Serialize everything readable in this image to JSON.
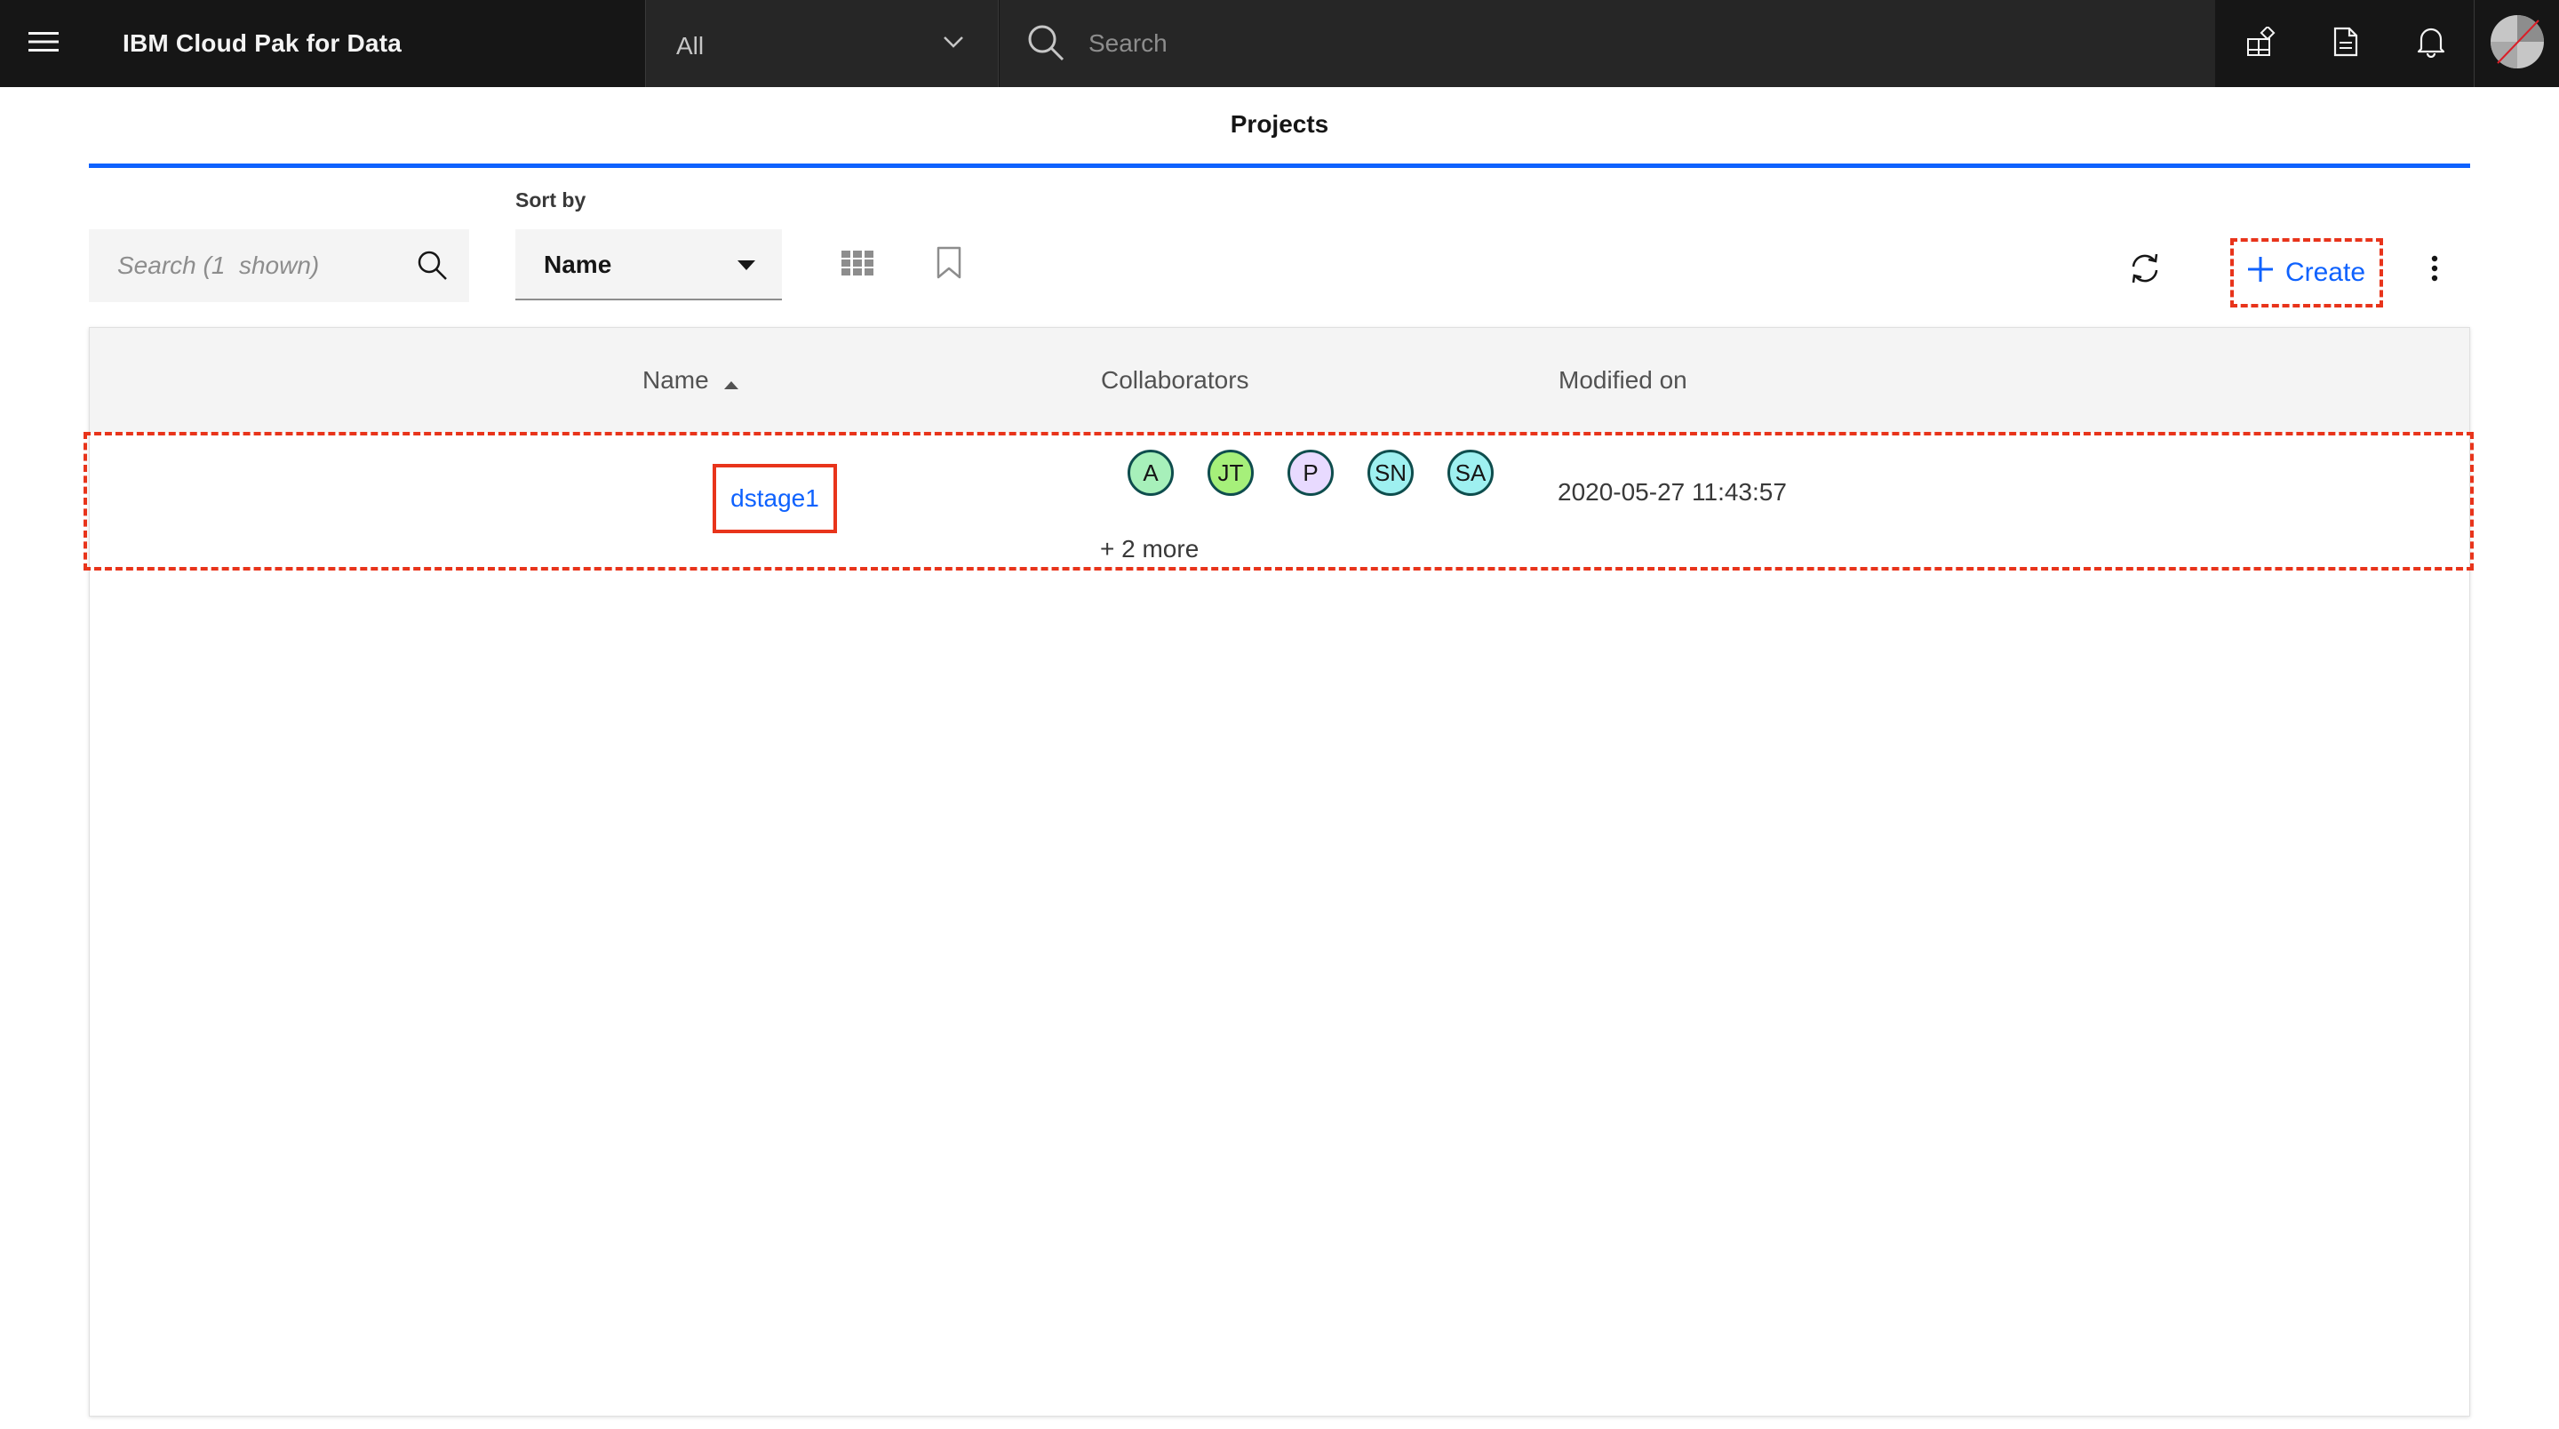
{
  "header": {
    "brand": "IBM Cloud Pak for Data",
    "scope_value": "All",
    "search_placeholder": "Search"
  },
  "page": {
    "title": "Projects"
  },
  "toolbar": {
    "filter_placeholder": "Search (1  shown)",
    "sort_label": "Sort by",
    "sort_value": "Name",
    "create_label": "Create"
  },
  "table": {
    "columns": [
      "Name",
      "Collaborators",
      "Modified on"
    ],
    "rows": [
      {
        "name": "dstage1",
        "collaborators": [
          {
            "initials": "A",
            "color": "#a7f0ba"
          },
          {
            "initials": "JT",
            "color": "#a6f07a"
          },
          {
            "initials": "P",
            "color": "#e8daff"
          },
          {
            "initials": "SN",
            "color": "#9ef0f0"
          },
          {
            "initials": "SA",
            "color": "#9ef0f0"
          }
        ],
        "more": "+ 2 more",
        "modified": "2020-05-27 11:43:57"
      }
    ]
  },
  "colors": {
    "header_bg": "#161616",
    "accent": "#0f62fe",
    "highlight": "#e8341b"
  }
}
